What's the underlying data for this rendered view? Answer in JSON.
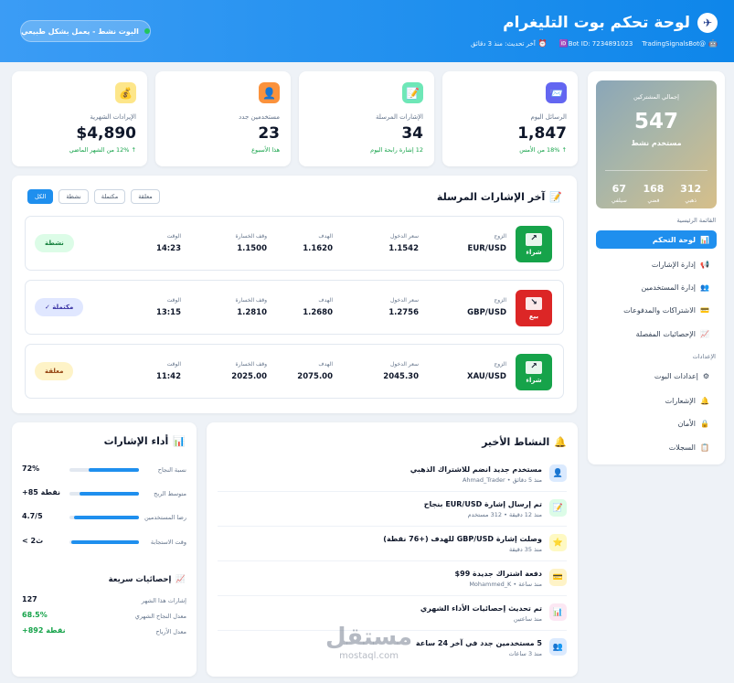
{
  "header": {
    "title": "لوحة تحكم بوت التليغرام",
    "logo_icon": "✈",
    "bot_username": "@TradingSignalsBot",
    "bot_id": "Bot ID: 7234891023",
    "last_update": "آخر تحديث: منذ 3 دقائق",
    "status": "البوت نشط - يعمل بشكل طبيعي"
  },
  "stats": [
    {
      "icon": "📨",
      "label": "الرسائل اليوم",
      "value": "1,847",
      "change": "↑ 18% من الأمس",
      "bg": "#6366f1"
    },
    {
      "icon": "📝",
      "label": "الإشارات المرسلة",
      "value": "34",
      "change": "12 إشارة رابحة اليوم",
      "bg": "#6ee7b7"
    },
    {
      "icon": "👤",
      "label": "مستخدمين جدد",
      "value": "23",
      "change": "هذا الأسبوع",
      "bg": "#fb923c"
    },
    {
      "icon": "💰",
      "label": "الإيرادات الشهرية",
      "value": "$4,890",
      "change": "↑ 12% من الشهر الماضي",
      "bg": "#fde68a"
    }
  ],
  "subscribers": {
    "label": "إجمالي المشتركين",
    "total": "547",
    "sublabel": "مستخدم نشط",
    "gold": {
      "n": "312",
      "label": "ذهبي"
    },
    "silver": {
      "n": "168",
      "label": "فضي"
    },
    "bronze": {
      "n": "67",
      "label": "سيلفي"
    }
  },
  "sidebar": {
    "section_main": "القائمة الرئيسية",
    "section_settings": "الإعدادات",
    "main_items": [
      {
        "icon": "📊",
        "label": "لوحة التحكم"
      },
      {
        "icon": "📢",
        "label": "إدارة الإشارات"
      },
      {
        "icon": "👥",
        "label": "إدارة المستخدمين"
      },
      {
        "icon": "💳",
        "label": "الاشتراكات والمدفوعات"
      },
      {
        "icon": "📈",
        "label": "الإحصائيات المفصلة"
      }
    ],
    "settings_items": [
      {
        "icon": "⚙",
        "label": "إعدادات البوت"
      },
      {
        "icon": "🔔",
        "label": "الإشعارات"
      },
      {
        "icon": "🔒",
        "label": "الأمان"
      },
      {
        "icon": "📋",
        "label": "السجلات"
      }
    ]
  },
  "signals": {
    "title": "آخر الإشارات المرسلة",
    "title_icon": "📝",
    "filters": [
      "الكل",
      "نشطة",
      "مكتملة",
      "معلقة"
    ],
    "labels": {
      "pair": "الزوج",
      "entry": "سعر الدخول",
      "target": "الهدف",
      "stop": "وقف الخسارة",
      "time": "الوقت"
    },
    "items": [
      {
        "type": "buy",
        "type_label": "شراء",
        "glyph": "↗",
        "pair": "EUR/USD",
        "entry": "1.1542",
        "target": "1.1620",
        "stop": "1.1500",
        "time": "14:23",
        "state": "نشطة",
        "state_class": "st-act"
      },
      {
        "type": "sell",
        "type_label": "بيع",
        "glyph": "↘",
        "pair": "GBP/USD",
        "entry": "1.2756",
        "target": "1.2680",
        "stop": "1.2810",
        "time": "13:15",
        "state": "مكتملة ✓",
        "state_class": "st-done"
      },
      {
        "type": "buy",
        "type_label": "شراء",
        "glyph": "↗",
        "pair": "XAU/USD",
        "entry": "2045.30",
        "target": "2075.00",
        "stop": "2025.00",
        "time": "11:42",
        "state": "معلقة",
        "state_class": "st-pend"
      }
    ]
  },
  "activity": {
    "title": "النشاط الأخير",
    "title_icon": "🔔",
    "items": [
      {
        "icon": "👤",
        "bg": "#dbeafe",
        "title": "مستخدم جديد انضم للاشتراك الذهبي",
        "sub": "منذ 5 دقائق • Ahmad_Trader"
      },
      {
        "icon": "📝",
        "bg": "#dcfce7",
        "title": "تم إرسال إشارة EUR/USD بنجاح",
        "sub": "منذ 12 دقيقة • 312 مستخدم"
      },
      {
        "icon": "⭐",
        "bg": "#fef9c3",
        "title": "وصلت إشارة GBP/USD للهدف (+76 نقطة)",
        "sub": "منذ 35 دقيقة"
      },
      {
        "icon": "💳",
        "bg": "#fef3c7",
        "title": "دفعة اشتراك جديدة 99$",
        "sub": "منذ ساعة • Mohammed_K"
      },
      {
        "icon": "📊",
        "bg": "#fce7f3",
        "title": "تم تحديث إحصائيات الأداء الشهري",
        "sub": "منذ ساعتين"
      },
      {
        "icon": "👥",
        "bg": "#dbeafe",
        "title": "5 مستخدمين جدد في آخر 24 ساعة",
        "sub": "منذ 3 ساعات"
      }
    ]
  },
  "performance": {
    "title": "أداء الإشارات",
    "title_icon": "📊",
    "rows": [
      {
        "label": "نسبة النجاح",
        "value": "72%",
        "fill": 0.72
      },
      {
        "label": "متوسط الربح",
        "value": "+85 نقطة",
        "fill": 0.85
      },
      {
        "label": "رضا المستخدمين",
        "value": "4.7/5",
        "fill": 0.94
      },
      {
        "label": "وقت الاستجابة",
        "value": "< 2ث",
        "fill": 0.98
      }
    ],
    "quick_title": "إحصائيات سريعة",
    "quick_icon": "📈",
    "quick": [
      {
        "label": "إشارات هذا الشهر",
        "value": "127",
        "color": "#0f172a"
      },
      {
        "label": "معدل النجاح الشهري",
        "value": "68.5%",
        "color": "#16a34a"
      },
      {
        "label": "معدل الأرباح",
        "value": "+892 نقطة",
        "color": "#16a34a"
      }
    ]
  },
  "watermark": {
    "ar": "مستقل",
    "en": "mostaql.com"
  }
}
